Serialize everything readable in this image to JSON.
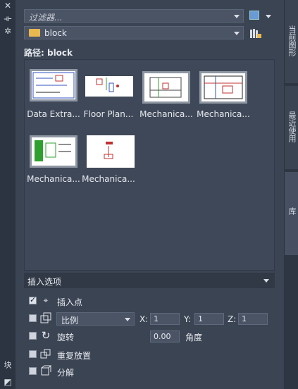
{
  "filter": {
    "placeholder": "过滤器..."
  },
  "folder": {
    "value": "block"
  },
  "path": {
    "label": "路径: block"
  },
  "thumbnails": [
    {
      "name": "Data Extra..."
    },
    {
      "name": "Floor Plan..."
    },
    {
      "name": "Mechanica..."
    },
    {
      "name": "Mechanica..."
    },
    {
      "name": "Mechanica..."
    },
    {
      "name": "Mechanica..."
    }
  ],
  "insert_options": {
    "title": "插入选项",
    "insertion_point": "插入点",
    "scale_select": "比例",
    "x_label": "X:",
    "x_value": "1",
    "y_label": "Y:",
    "y_value": "1",
    "z_label": "Z:",
    "z_value": "1",
    "rotate": "旋转",
    "angle_value": "0.00",
    "angle_label": "角度",
    "repeat": "重复放置",
    "explode": "分解"
  },
  "tabs": {
    "current": "当前图形",
    "recent": "最近使用",
    "library": "库"
  },
  "left_label": "块"
}
